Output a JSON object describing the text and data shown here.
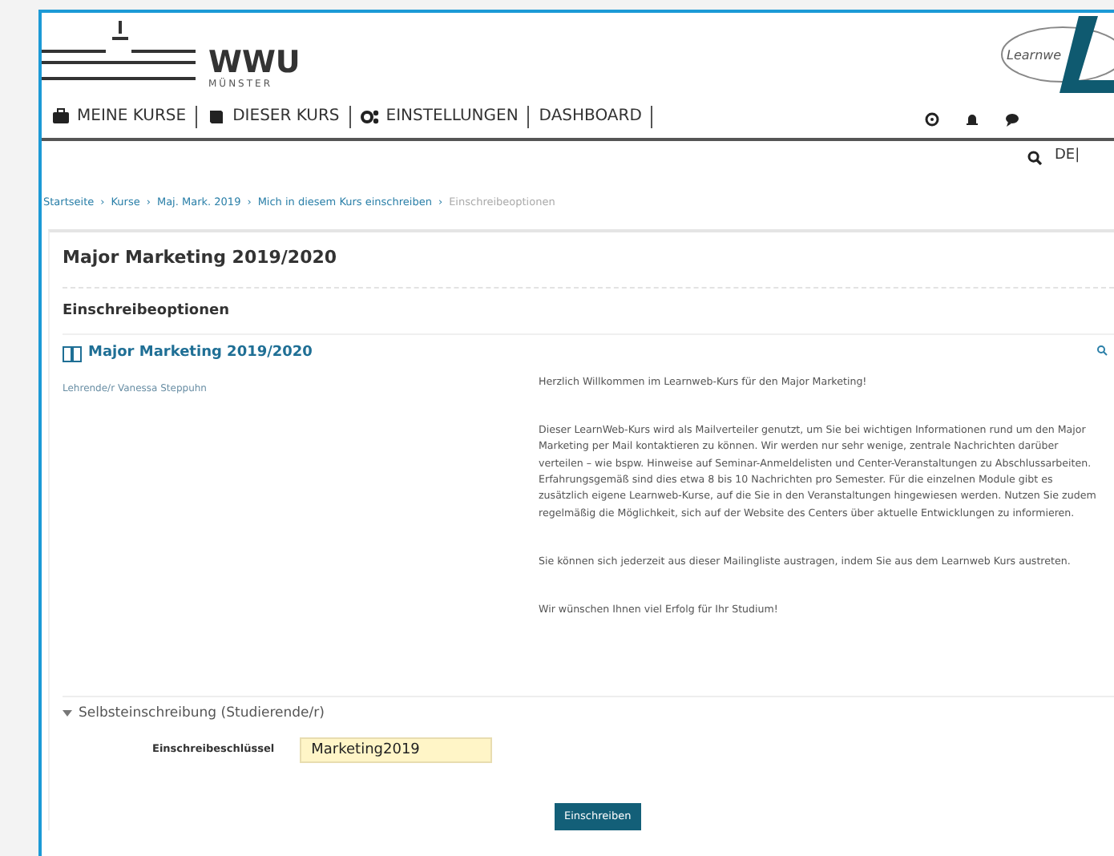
{
  "header": {
    "logo_title": "WWU",
    "logo_subtitle": "MÜNSTER",
    "learnweb_logo_text": "Learnwe"
  },
  "nav": {
    "items": [
      {
        "label": "MEINE KURSE"
      },
      {
        "label": "DIESER KURS"
      },
      {
        "label": "EINSTELLUNGEN"
      },
      {
        "label": "DASHBOARD"
      }
    ],
    "language": "DE|"
  },
  "breadcrumb": {
    "separator": "›",
    "items": [
      "Startseite",
      "Kurse",
      "Maj. Mark. 2019",
      "Mich in diesem Kurs einschreiben",
      "Einschreibeoptionen"
    ]
  },
  "page_title": "Major Marketing 2019/2020",
  "section_title": "Einschreibeoptionen",
  "course": {
    "title": "Major Marketing 2019/2020",
    "teacher": "Lehrende/r Vanessa Steppuhn",
    "summary": [
      "Herzlich Willkommen im Learnweb-Kurs für den Major Marketing!",
      "Dieser LearnWeb-Kurs wird als Mailverteiler genutzt, um Sie bei wichtigen Informationen rund um den Major Marketing per Mail kontaktieren zu können. Wir werden nur sehr wenige, zentrale Nachrichten darüber verteilen – wie bspw. Hinweise auf Seminar-Anmeldelisten und Center-Veranstaltungen zu Abschlussarbeiten. Erfahrungsgemäß sind dies etwa 8 bis 10 Nachrichten pro Semester. Für die einzelnen Module gibt es zusätzlich eigene Learnweb-Kurse, auf die Sie in den Veranstaltungen hingewiesen werden. Nutzen Sie zudem regelmäßig die Möglichkeit, sich auf der Website des Centers über aktuelle Entwicklungen zu informieren.",
      "Sie können sich jederzeit aus dieser Mailingliste austragen, indem Sie aus dem Learnweb Kurs austreten.",
      "Wir wünschen Ihnen viel Erfolg für Ihr Studium!"
    ]
  },
  "enrolment": {
    "title": "Selbsteinschreibung (Studierende/r)",
    "expanded": true,
    "key_label": "Einschreibeschlüssel",
    "key_value": "Marketing2019",
    "button": "Einschreiben"
  }
}
